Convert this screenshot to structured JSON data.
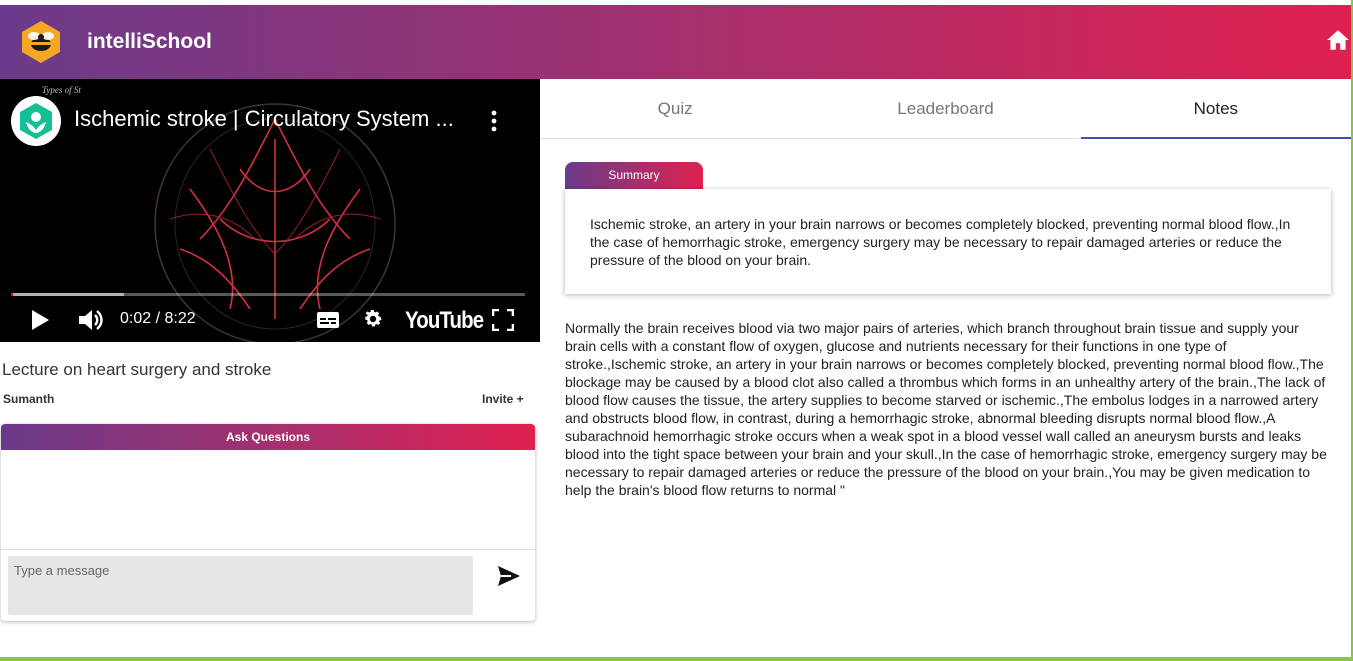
{
  "header": {
    "app_title": "intelliSchool"
  },
  "video": {
    "title": "Ischemic stroke | Circulatory System ...",
    "handwritten_caption": "Types of St",
    "time": "0:02 / 8:22",
    "progress_played_fraction": 0.004,
    "progress_loaded_fraction": 0.22,
    "brand": "YouTube"
  },
  "lecture": {
    "title": "Lecture on heart surgery and stroke",
    "author": "Sumanth",
    "invite_label": "Invite +"
  },
  "ask": {
    "header": "Ask Questions",
    "placeholder": "Type a message"
  },
  "tabs": [
    {
      "label": "Quiz",
      "active": false
    },
    {
      "label": "Leaderboard",
      "active": false
    },
    {
      "label": "Notes",
      "active": true
    }
  ],
  "notes": {
    "summary_label": "Summary",
    "summary_text": "Ischemic stroke, an artery in your brain narrows or becomes completely blocked, preventing normal blood flow.,In the case of hemorrhagic stroke, emergency surgery may be necessary to repair damaged arteries or reduce the pressure of the blood on your brain.",
    "full_text": "Normally the brain receives blood via two major pairs of arteries, which branch throughout brain tissue and supply your brain cells with a constant flow of oxygen, glucose and nutrients necessary for their functions in one type of stroke.,Ischemic stroke, an artery in your brain narrows or becomes completely blocked, preventing normal blood flow.,The blockage may be caused by a blood clot also called a thrombus which forms in an unhealthy artery of the brain.,The lack of blood flow causes the tissue, the artery supplies to become starved or ischemic.,The embolus lodges in a narrowed artery and obstructs blood flow, in contrast, during a hemorrhagic stroke, abnormal bleeding disrupts normal blood flow.,A subarachnoid hemorrhagic stroke occurs when a weak spot in a blood vessel wall called an aneurysm bursts and leaks blood into the tight space between your brain and your skull.,In the case of hemorrhagic stroke, emergency surgery may be necessary to repair damaged arteries or reduce the pressure of the blood on your brain.,You may be given medication to help the brain's blood flow returns to normal \""
  },
  "colors": {
    "gradient_start": "#6b3a8a",
    "gradient_end": "#e0204f",
    "tab_indicator": "#3f51b5",
    "page_border": "#8bc34a"
  },
  "icons": {
    "logo": "bee-hexagon-logo",
    "home": "home-icon",
    "send": "send-icon",
    "channel": "khan-academy-logo"
  }
}
